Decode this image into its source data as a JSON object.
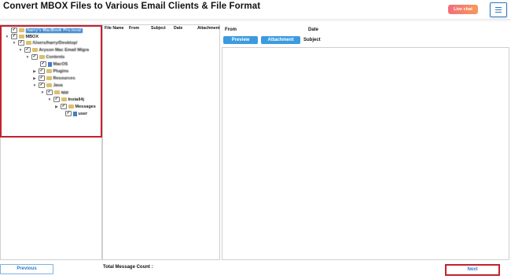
{
  "header": {
    "title": "Convert MBOX Files to Various Email Clients & File Format",
    "live_chat_label": "Live chat",
    "menu_icon": "hamburger-icon"
  },
  "tree": {
    "items": [
      {
        "label": "harry's MacBook Pro.local"
      },
      {
        "label": "MBOX"
      },
      {
        "label": "/Users/harry/Desktop/"
      },
      {
        "label": "Aryson Mac Email Migra"
      },
      {
        "label": "Contents"
      },
      {
        "label": "MacOS"
      },
      {
        "label": "Plugins"
      },
      {
        "label": "Resources"
      },
      {
        "label": "Java"
      },
      {
        "label": "app"
      },
      {
        "label": "Install4j"
      },
      {
        "label": "Messages"
      },
      {
        "label": "user"
      }
    ]
  },
  "message_list": {
    "columns": [
      "File Name",
      "From",
      "Subject",
      "Date",
      "Attachment"
    ]
  },
  "preview": {
    "from_label": "From",
    "date_label": "Date",
    "preview_button": "Preview",
    "attachment_button": "Attachment",
    "subject_label": "Subject"
  },
  "footer": {
    "previous_label": "Previous",
    "total_count_label": "Total Message Count :",
    "next_label": "Next"
  }
}
